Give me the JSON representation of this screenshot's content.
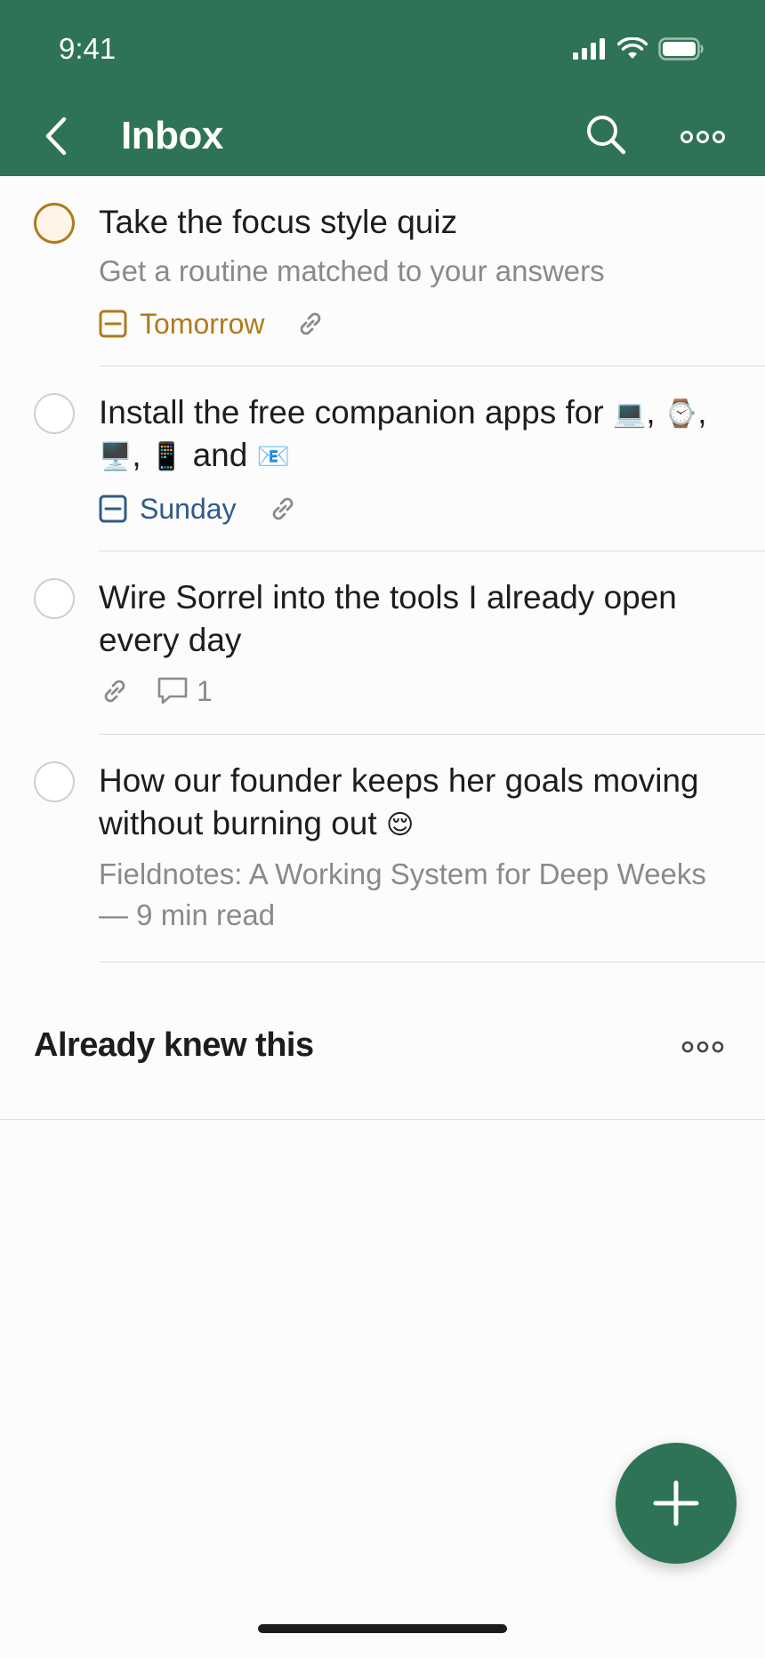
{
  "status_bar": {
    "time": "9:41"
  },
  "header": {
    "title": "Inbox"
  },
  "tasks": [
    {
      "title": "Take the focus style quiz",
      "description": "Get a routine matched to your answers",
      "due": "Tomorrow",
      "due_color": "#b07a1c",
      "priority": "p1"
    },
    {
      "title_prefix": "Install the free companion apps for",
      "title_and": "and",
      "devices": [
        "laptop",
        "watch",
        "desktop",
        "phone",
        "email"
      ],
      "device_emoji": [
        "💻",
        "⌚",
        "🖥️",
        "📱",
        "📧"
      ],
      "due": "Sunday",
      "due_color": "#2f5b8a"
    },
    {
      "title": "Wire Sorrel into the tools I already open every day",
      "comment_count": "1"
    },
    {
      "title": "How our founder keeps her goals moving without burning out",
      "title_emoji": "😌",
      "description": "Fieldnotes: A Working System for Deep Weeks — 9 min read"
    }
  ],
  "section": {
    "title": "Already knew this"
  },
  "colors": {
    "brand": "#2f7356",
    "priority1": "#b07a1c",
    "due_sunday": "#2f5b8a",
    "muted": "#8a8a8a"
  }
}
